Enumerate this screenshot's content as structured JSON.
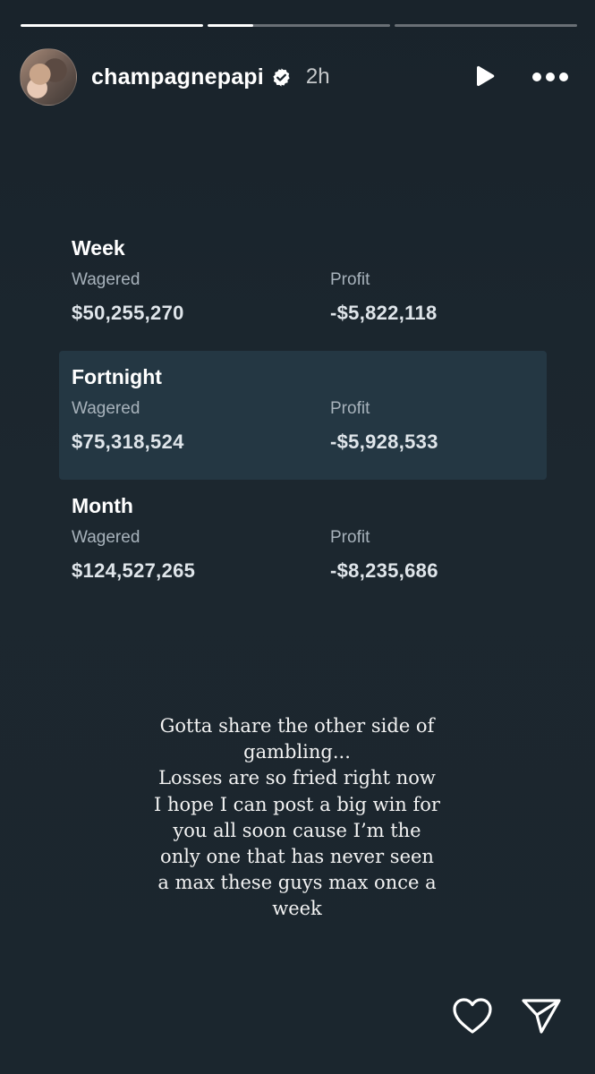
{
  "progress": [
    {
      "fraction": 1.0
    },
    {
      "fraction": 0.25
    },
    {
      "fraction": 0.0
    }
  ],
  "header": {
    "username": "champagnepapi",
    "time": "2h",
    "verified_icon": "verified-badge-icon",
    "play_icon": "play-icon",
    "more_icon": "more-dots-icon"
  },
  "stats": {
    "periods": [
      {
        "title": "Week",
        "wagered_label": "Wagered",
        "wagered": "$50,255,270",
        "profit_label": "Profit",
        "profit": "-$5,822,118"
      },
      {
        "title": "Fortnight",
        "wagered_label": "Wagered",
        "wagered": "$75,318,524",
        "profit_label": "Profit",
        "profit": "-$5,928,533"
      },
      {
        "title": "Month",
        "wagered_label": "Wagered",
        "wagered": "$124,527,265",
        "profit_label": "Profit",
        "profit": "-$8,235,686"
      }
    ],
    "highlight_color": "#243743"
  },
  "caption": "Gotta share the other side of\ngambling...\nLosses are so fried right now\nI hope I can post a big win for\nyou all soon cause I’m the\nonly one that has never seen\na max these guys max once a\nweek",
  "footer": {
    "like_icon": "heart-icon",
    "share_icon": "send-icon"
  },
  "colors": {
    "background": "#1b252d",
    "text": "#ffffff",
    "muted": "#a7b2bb"
  }
}
